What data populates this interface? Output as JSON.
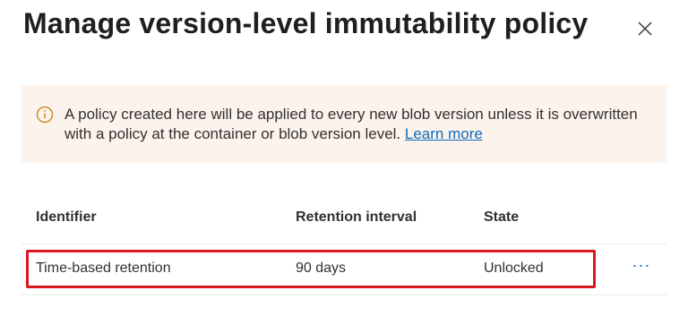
{
  "panel": {
    "title": "Manage version-level immutability policy",
    "close_icon": "close-icon"
  },
  "banner": {
    "icon": "info-icon",
    "text": "A policy created here will be applied to every new blob version unless it is overwritten with a policy at the container or blob version level.",
    "link_label": "Learn more",
    "background": "#fdf3ed",
    "icon_color": "#c8811a"
  },
  "table": {
    "headers": [
      "Identifier",
      "Retention interval",
      "State"
    ],
    "rows": [
      {
        "identifier": "Time-based retention",
        "retention_interval": "90 days",
        "state": "Unlocked",
        "actions_label": "···"
      }
    ]
  },
  "colors": {
    "link": "#0f6cbd",
    "highlight": "#d9191f",
    "divider": "#edebe9"
  }
}
